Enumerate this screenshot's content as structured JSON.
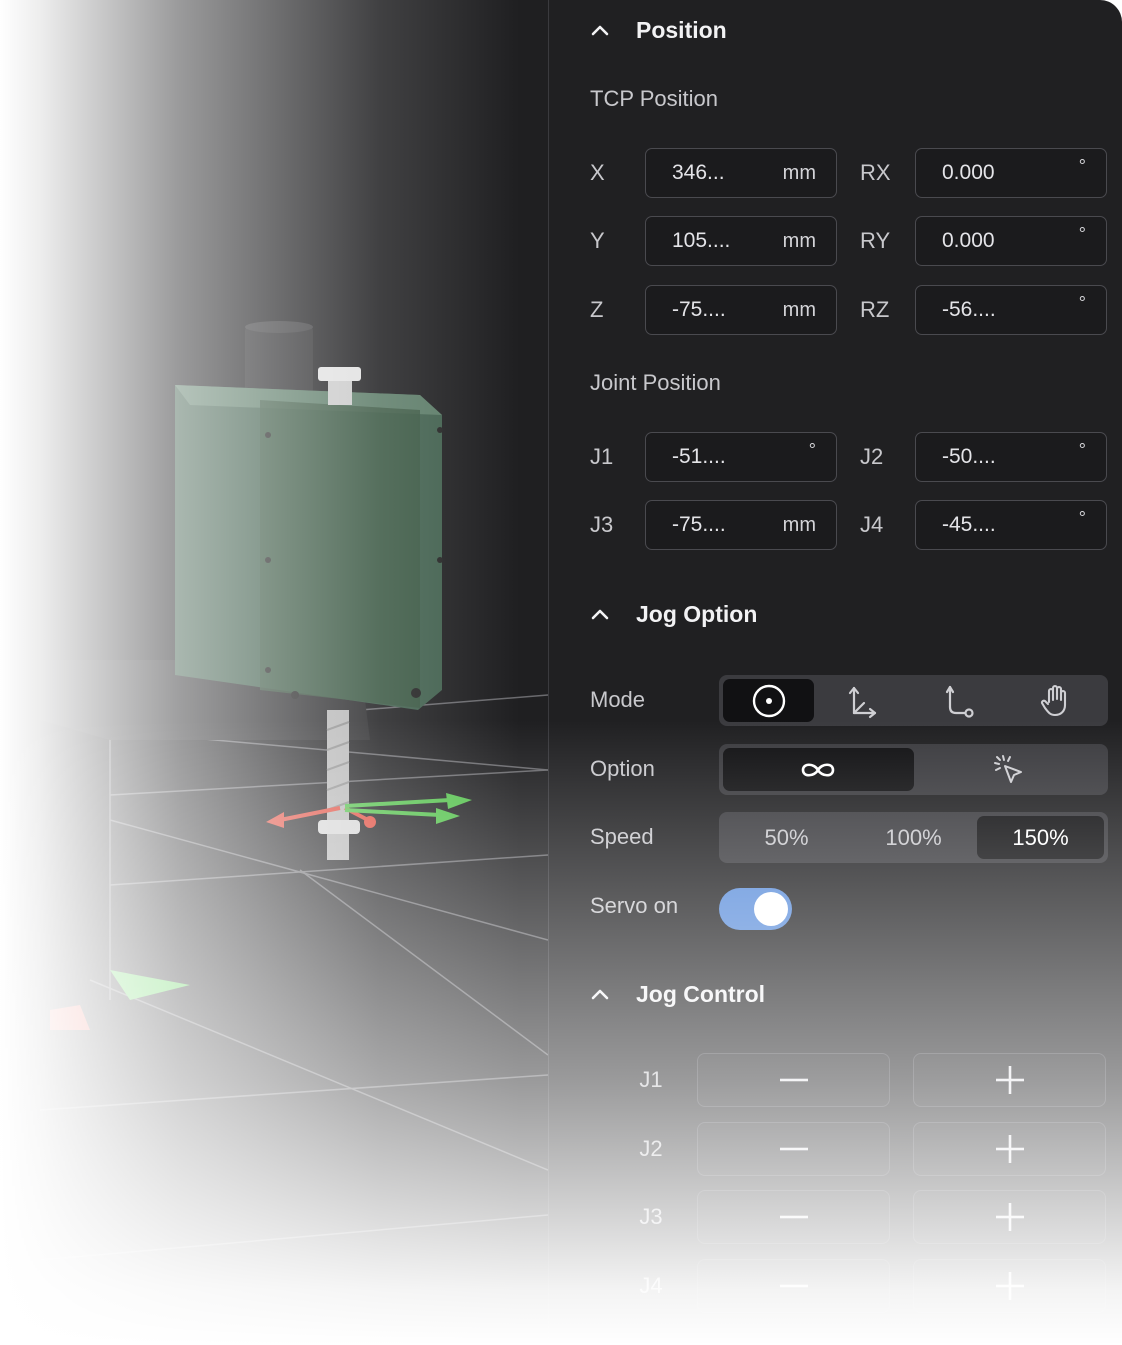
{
  "position": {
    "title": "Position",
    "tcp": {
      "label": "TCP Position",
      "rows": [
        {
          "axis": "X",
          "value": "346...",
          "unit": "mm",
          "raxis": "RX",
          "rvalue": "0.000",
          "runit": "°"
        },
        {
          "axis": "Y",
          "value": "105....",
          "unit": "mm",
          "raxis": "RY",
          "rvalue": "0.000",
          "runit": "°"
        },
        {
          "axis": "Z",
          "value": "-75....",
          "unit": "mm",
          "raxis": "RZ",
          "rvalue": "-56....",
          "runit": "°"
        }
      ]
    },
    "joint": {
      "label": "Joint Position",
      "rows": [
        {
          "axis": "J1",
          "value": "-51....",
          "unit": "°",
          "raxis": "J2",
          "rvalue": "-50....",
          "runit": "°"
        },
        {
          "axis": "J3",
          "value": "-75....",
          "unit": "mm",
          "raxis": "J4",
          "rvalue": "-45....",
          "runit": "°"
        }
      ]
    }
  },
  "jog_option": {
    "title": "Jog Option",
    "mode_label": "Mode",
    "mode_icons": [
      "target-icon",
      "base-frame-icon",
      "tool-frame-icon",
      "hand-icon"
    ],
    "mode_selected": 0,
    "option_label": "Option",
    "option_icons": [
      "infinity-icon",
      "click-pointer-icon"
    ],
    "option_selected": 0,
    "speed_label": "Speed",
    "speed_options": [
      "50%",
      "100%",
      "150%"
    ],
    "speed_selected": 2,
    "servo_label": "Servo on",
    "servo_on": true
  },
  "jog_control": {
    "title": "Jog Control",
    "joints": [
      "J1",
      "J2",
      "J3",
      "J4"
    ]
  },
  "colors": {
    "toggle_on": "#5b8edb",
    "object_green": "#3f5e4c"
  }
}
